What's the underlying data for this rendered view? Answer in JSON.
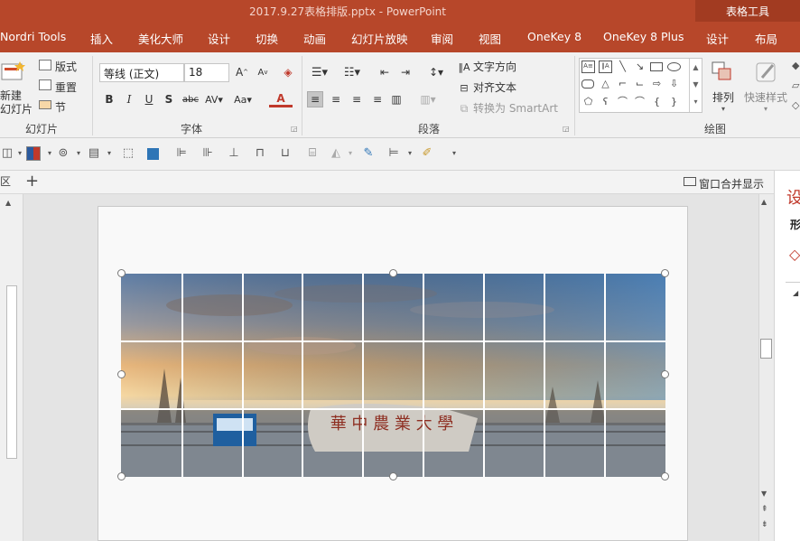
{
  "window": {
    "title": "2017.9.27表格排版.pptx  -  PowerPoint",
    "context_group": "表格工具"
  },
  "tabs": [
    "Nordri Tools",
    "插入",
    "美化大师",
    "设计",
    "切换",
    "动画",
    "幻灯片放映",
    "审阅",
    "视图",
    "OneKey 8",
    "OneKey 8 Plus",
    "设计",
    "布局"
  ],
  "ribbon": {
    "slides": {
      "new_slide": "新建\n幻灯片",
      "layout": "版式",
      "reset": "重置",
      "section": "节",
      "group_label": "幻灯片"
    },
    "font": {
      "font_name": "等线 (正文)",
      "font_size": "18",
      "group_label": "字体"
    },
    "paragraph": {
      "text_direction": "文字方向",
      "align_text": "对齐文本",
      "convert_smartart": "转换为 SmartArt",
      "group_label": "段落"
    },
    "drawing": {
      "arrange": "排列",
      "quick_styles": "快速样式",
      "group_label": "绘图"
    }
  },
  "docstrip": {
    "merge_windows": "窗口合并显示"
  },
  "right_pane": {
    "title": "设",
    "subtitle": "形"
  },
  "colors": {
    "accent": "#b7472a",
    "accent_dark": "#a23b21",
    "ribbon_bg": "#f1f1f1"
  }
}
